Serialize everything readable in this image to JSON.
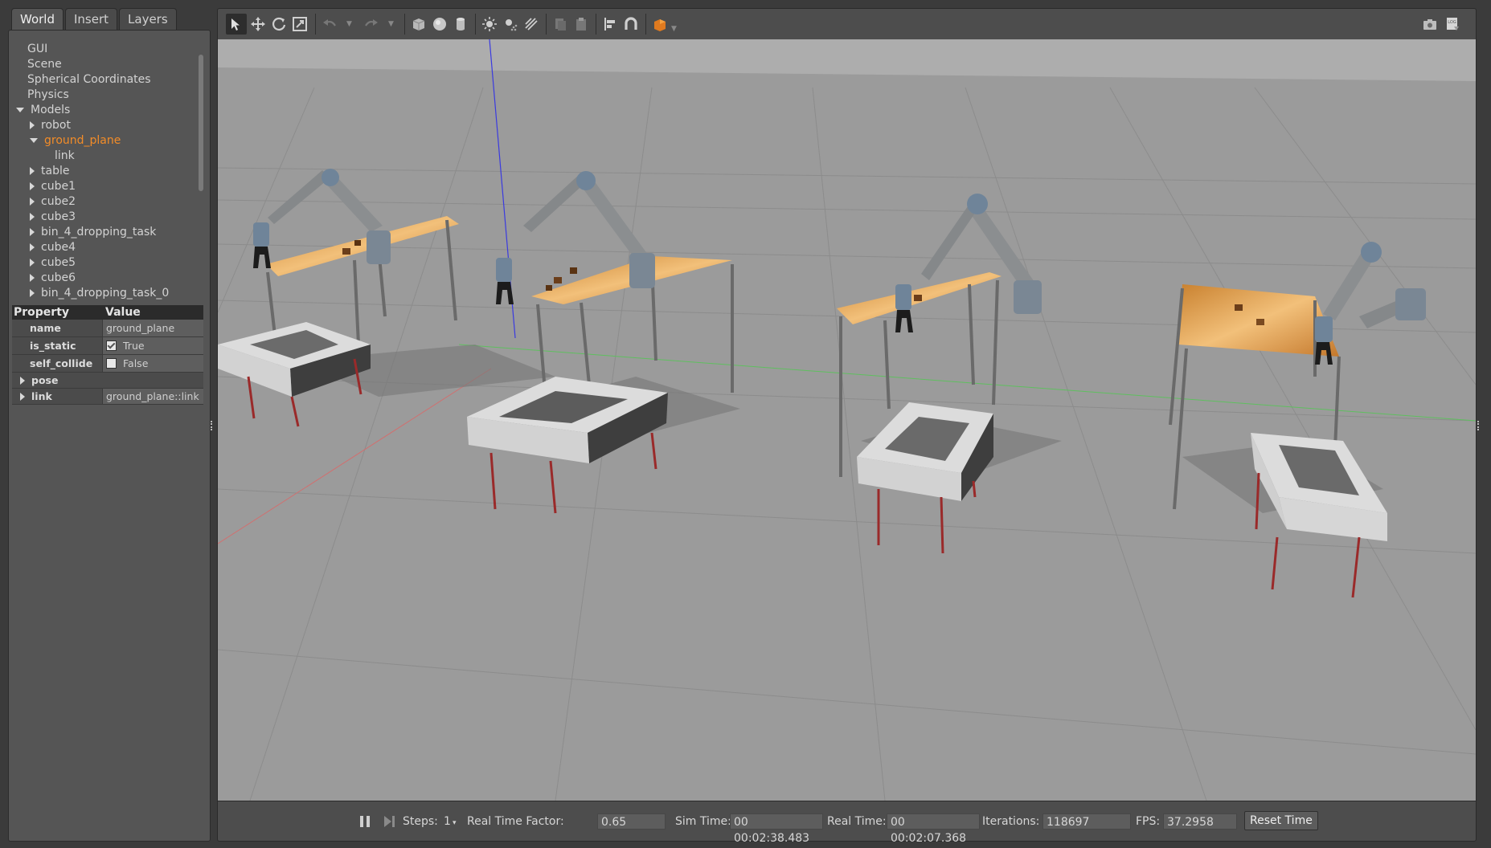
{
  "tabs": [
    "World",
    "Insert",
    "Layers"
  ],
  "tree": [
    {
      "label": "GUI",
      "indent": 0,
      "arrow": "none",
      "selected": false
    },
    {
      "label": "Scene",
      "indent": 0,
      "arrow": "none",
      "selected": false
    },
    {
      "label": "Spherical Coordinates",
      "indent": 0,
      "arrow": "none",
      "selected": false
    },
    {
      "label": "Physics",
      "indent": 0,
      "arrow": "none",
      "selected": false
    },
    {
      "label": "Models",
      "indent": 0,
      "arrow": "down",
      "selected": false
    },
    {
      "label": "robot",
      "indent": 1,
      "arrow": "right",
      "selected": false
    },
    {
      "label": "ground_plane",
      "indent": 1,
      "arrow": "down",
      "selected": true
    },
    {
      "label": "link",
      "indent": 2,
      "arrow": "none",
      "selected": false
    },
    {
      "label": "table",
      "indent": 1,
      "arrow": "right",
      "selected": false
    },
    {
      "label": "cube1",
      "indent": 1,
      "arrow": "right",
      "selected": false
    },
    {
      "label": "cube2",
      "indent": 1,
      "arrow": "right",
      "selected": false
    },
    {
      "label": "cube3",
      "indent": 1,
      "arrow": "right",
      "selected": false
    },
    {
      "label": "bin_4_dropping_task",
      "indent": 1,
      "arrow": "right",
      "selected": false
    },
    {
      "label": "cube4",
      "indent": 1,
      "arrow": "right",
      "selected": false
    },
    {
      "label": "cube5",
      "indent": 1,
      "arrow": "right",
      "selected": false
    },
    {
      "label": "cube6",
      "indent": 1,
      "arrow": "right",
      "selected": false
    },
    {
      "label": "bin_4_dropping_task_0",
      "indent": 1,
      "arrow": "right",
      "selected": false
    }
  ],
  "properties": {
    "header_property": "Property",
    "header_value": "Value",
    "name_key": "name",
    "name_value": "ground_plane",
    "is_static_key": "is_static",
    "is_static_value": "True",
    "self_collide_key": "self_collide",
    "self_collide_value": "False",
    "pose_label": "pose",
    "link_key": "link",
    "link_value": "ground_plane::link"
  },
  "toolbar_icons": [
    "select-arrow-icon",
    "translate-icon",
    "rotate-icon",
    "scale-icon",
    "undo-icon",
    "redo-icon",
    "box-icon",
    "sphere-icon",
    "cylinder-icon",
    "point-light-icon",
    "spot-light-icon",
    "directional-light-icon",
    "copy-icon",
    "paste-icon",
    "align-icon",
    "snap-magnet-icon",
    "view-angle-icon",
    "screenshot-icon",
    "log-icon"
  ],
  "bottom": {
    "steps_label": "Steps:",
    "steps_value": "1",
    "rtf_label": "Real Time Factor:",
    "rtf_value": "0.65",
    "sim_time_label": "Sim Time:",
    "sim_time_value": "00 00:02:38.483",
    "real_time_label": "Real Time:",
    "real_time_value": "00 00:02:07.368",
    "iterations_label": "Iterations:",
    "iterations_value": "118697",
    "fps_label": "FPS:",
    "fps_value": "37.2958",
    "reset_label": "Reset Time"
  },
  "colors": {
    "ground": "#9a9a9a",
    "sky": "#a8a8a8",
    "table_top": "#d99a4a",
    "bin": "#d6d6d6",
    "bin_legs": "#a02a2a",
    "robot": "#8d9092",
    "robot_joint": "#6f8499",
    "accent_selected": "#f28c28"
  }
}
